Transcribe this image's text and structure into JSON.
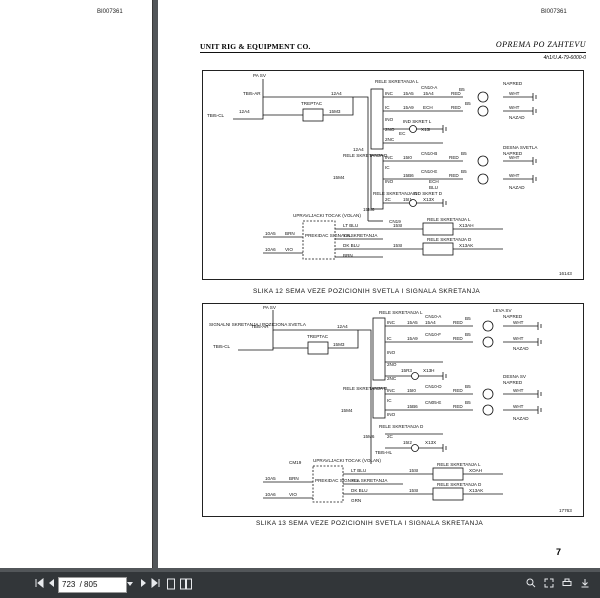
{
  "left_page": {
    "doc_id": "BI007361"
  },
  "right_page": {
    "doc_id": "BI007361",
    "header_left": "UNIT RIG & EQUIPMENT CO.",
    "header_right": "OPREMA PO ZAHTEVU",
    "header_ref": "4h1/U.A-79-6000-0",
    "page_number": "7"
  },
  "figure1": {
    "caption": "SLIKA 12  SEMA VEZE POZICIONIH SVETLA I SIGNALA SKRETANJA",
    "fig_ref": "16143",
    "labels": {
      "pa_sv": "PA SV",
      "tbi5_ar": "TBI5-AR",
      "tbi5_cl": "TBI5-CL",
      "w12a4": "12A4",
      "w12a4b": "12A4",
      "w12a4c": "12A4",
      "w15m3": "15M3",
      "w15m4": "15M4",
      "w15m6": "15M6",
      "w15m3b": "15M3",
      "w15m4b": "15M4",
      "treptac": "TREPTAC",
      "rele_l": "RELE SKRETANJA L",
      "rele_d": "RELE SKRETANJA D",
      "rele_d2": "RELE SKRETANJA D",
      "ind_skret_l": "IND SKRET L",
      "ind_skret_d": "IND SKRET D",
      "desna_svetla": "DESNA SVETLA",
      "napred": "NAPRED",
      "nazad": "NAZAD",
      "napred2": "NAPRED",
      "nazad2": "NAZAD",
      "tbi5_dl": "TBI5-DL",
      "cn10_a": "CN10-A",
      "cn10_b": "CN10-B",
      "cn10_c": "CN10-C",
      "cn10_d": "CN10-D",
      "cn10_e": "CN10-E",
      "ech": "ECH",
      "ech2": "ECH",
      "red": "RED",
      "red2": "RED",
      "red3": "RED",
      "red4": "RED",
      "wht": "WHT",
      "wht2": "WHT",
      "wht3": "WHT",
      "wht4": "WHT",
      "blu": "BLU",
      "b5": "B5",
      "b5b": "B5",
      "b5c": "B5",
      "b5d": "B5",
      "s15a4": "15A4",
      "s15a5": "15A5",
      "s15a6": "15A6",
      "s15a8": "15A8",
      "s15b6": "15B6",
      "s15b8": "15B8",
      "s15b4": "15B4",
      "s15b5": "15B5",
      "s15a9": "15A9",
      "s15b9": "15B9",
      "s15i0": "15I0",
      "s15i1": "15I1",
      "s15i2": "15I2",
      "s15i5": "15I5",
      "s15i6": "15I6",
      "x13h": "X13H",
      "x13i": "X13I",
      "x13x": "X13X",
      "x13ah": "X13AH",
      "x13ak": "X13AK",
      "inc": "INC",
      "inc2": "INC",
      "inc3": "INC",
      "ino": "INO",
      "ino2": "INO",
      "ic": "IC",
      "ic2": "IC",
      "no2": "2NO",
      "no2b": "2NO",
      "nc2": "2NC",
      "nc2b": "2NC",
      "c2": "2C",
      "c2b": "2C",
      "ec": "EC",
      "upravljacki": "UPRAVLJACKI TOCAK (VOLAN)",
      "cn19": "CN19",
      "cn19b": "CN19",
      "prekidac": "PREKIDAC SIGNALA SKRETANJA",
      "lt_blu": "LT BLU",
      "yel": "YEL",
      "dk_blu": "DK BLU",
      "brn": "BRN",
      "brn2": "BRN",
      "vio": "VIO",
      "s10a5": "10A5",
      "s10a6": "10A6",
      "s15si": "15SI",
      "s15s": "15SI",
      "rele_skr_l": "RELE SKRETANJA L",
      "rele_skr_d": "RELE SKRETANJA D"
    }
  },
  "figure2": {
    "caption": "SLIKA 13  SEMA VEZE POZICIONIH SVETLA I SIGNALA SKRETANJA",
    "fig_ref": "17763",
    "labels": {
      "pa_sv": "PA SV",
      "signalni": "SIGNALNI SKRETANJA I POZICIONA SVETLA",
      "tbi5_ar": "TBI5-AR",
      "tbi5_cl": "TBI5-CL",
      "w12a4": "12A4",
      "w15m3": "15M3",
      "w15m4": "15M4",
      "w15m6": "15M6",
      "treptac": "TREPTAC",
      "rele_l": "RELE SKRETANJA L",
      "rele_d": "RELE SKRETANJA D",
      "rele_d2": "RELE SKRETANJA D",
      "leva_sv": "LEVA SV",
      "desna_sv": "DESNA SV",
      "napred": "NAPRED",
      "nazad": "NAZAD",
      "napred2": "NAPRED",
      "nazad2": "NAZAD",
      "cn10_a": "CN10-A",
      "cn10_f": "CN10-F",
      "cn10_d": "CN10-D",
      "cn05_e": "CN05-E",
      "cn10_e": "CN10-E",
      "red": "RED",
      "red2": "RED",
      "red3": "RED",
      "red4": "RED",
      "wht": "WHT",
      "wht2": "WHT",
      "wht3": "WHT",
      "wht4": "WHT",
      "b5": "B5",
      "b5b": "B5",
      "b5c": "B5",
      "b5d": "B5",
      "s15a4": "15A4",
      "s15a5": "15A5",
      "s15a6": "15A6",
      "s15a8": "15A8",
      "s15a9": "15A9",
      "s15b6": "15B6",
      "s15b8": "15B8",
      "s15b9": "15B9",
      "s15b4": "15B4",
      "s15b5": "15B5",
      "s15i0": "15I0",
      "s15i1": "15I1",
      "s15i2": "15I2",
      "s15r3": "15R3",
      "s15s1": "15S1",
      "x13x": "X13X",
      "x13h": "X13H",
      "x13ah": "X13AH",
      "x13ak": "X13AK",
      "inc": "INC",
      "ino": "INO",
      "ic": "IC",
      "inc2": "INC",
      "ino2": "INO",
      "ic2": "IC",
      "no2": "2NO",
      "nc2": "2NC",
      "c2": "2C",
      "c2b": "2C",
      "no2b": "2NO",
      "nc2b": "2NC",
      "upravljacki": "UPRAVLJACKI TOCAK (VOLAN)",
      "cmb": "CM19",
      "prekidac": "PREKIDAC SIGNALA SKRETANJA",
      "lt_blu": "LT BLU",
      "yel": "YEL",
      "dk_blu": "DK BLU",
      "brn": "BRN",
      "grn": "GRN",
      "vio": "VIO",
      "s10a5": "10A5",
      "s10a6": "10A6",
      "s15si": "15SI",
      "s15s": "15SI",
      "rele_skr_l": "RELE SKRETANJA L",
      "rele_skr_d": "RELE SKRETANJA D",
      "xoah": "XOAH",
      "tbi5_hl": "TBI5-HL"
    }
  },
  "toolbar": {
    "page_current": "723",
    "page_total": "/ 805",
    "first_icon": "first-page-icon",
    "prev_icon": "prev-page-icon",
    "next_icon": "next-page-icon",
    "last_icon": "last-page-icon",
    "colors": {
      "bar": "#323639",
      "text": "#e8eaed"
    }
  }
}
